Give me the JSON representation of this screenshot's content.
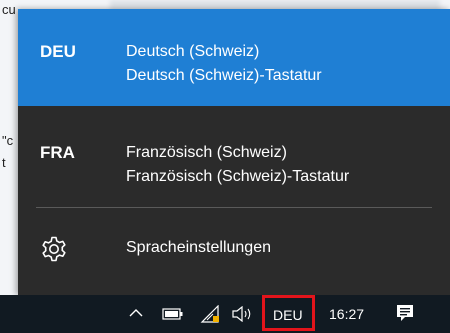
{
  "background": {
    "fragments": [
      "cu",
      "\"c",
      "t"
    ]
  },
  "flyout": {
    "languages": [
      {
        "code": "DEU",
        "name": "Deutsch (Schweiz)",
        "keyboard": "Deutsch (Schweiz)-Tastatur",
        "selected": true
      },
      {
        "code": "FRA",
        "name": "Französisch (Schweiz)",
        "keyboard": "Französisch (Schweiz)-Tastatur",
        "selected": false
      }
    ],
    "settings_label": "Spracheinstellungen",
    "settings_icon": "gear-icon"
  },
  "taskbar": {
    "ime_label": "DEU",
    "clock": "16:27",
    "icons": [
      "chevron-up-icon",
      "battery-icon",
      "network-icon",
      "speaker-icon",
      "notification-icon"
    ]
  },
  "colors": {
    "selected": "#1f7fd4",
    "flyout_bg": "#2b2b2b",
    "taskbar_bg": "#111a22",
    "highlight_border": "#e3141b"
  }
}
